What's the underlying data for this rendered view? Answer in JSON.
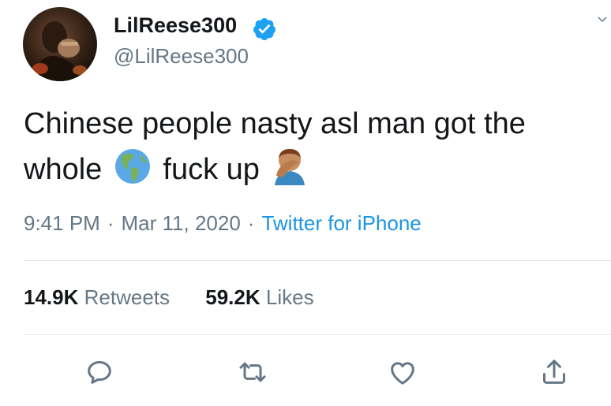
{
  "user": {
    "display_name": "LilReese300",
    "handle": "@LilReese300",
    "verified": true
  },
  "tweet": {
    "text_line1": "Chinese people nasty asl man got the",
    "text_line2_before": "whole",
    "text_line2_after": "fuck up",
    "emoji": [
      "globe-americas-icon",
      "facepalm-icon"
    ]
  },
  "meta": {
    "time": "9:41 PM",
    "separator": "·",
    "date": "Mar 11, 2020",
    "source": "Twitter for iPhone"
  },
  "stats": {
    "retweets_count": "14.9K",
    "retweets_label": "Retweets",
    "likes_count": "59.2K",
    "likes_label": "Likes"
  },
  "actions": [
    "reply-icon",
    "retweet-icon",
    "like-icon",
    "share-icon"
  ],
  "colors": {
    "text": "#14171a",
    "secondary": "#657786",
    "link": "#1b95e0",
    "divider": "#e1e8ed",
    "verified": "#1da1f2"
  }
}
